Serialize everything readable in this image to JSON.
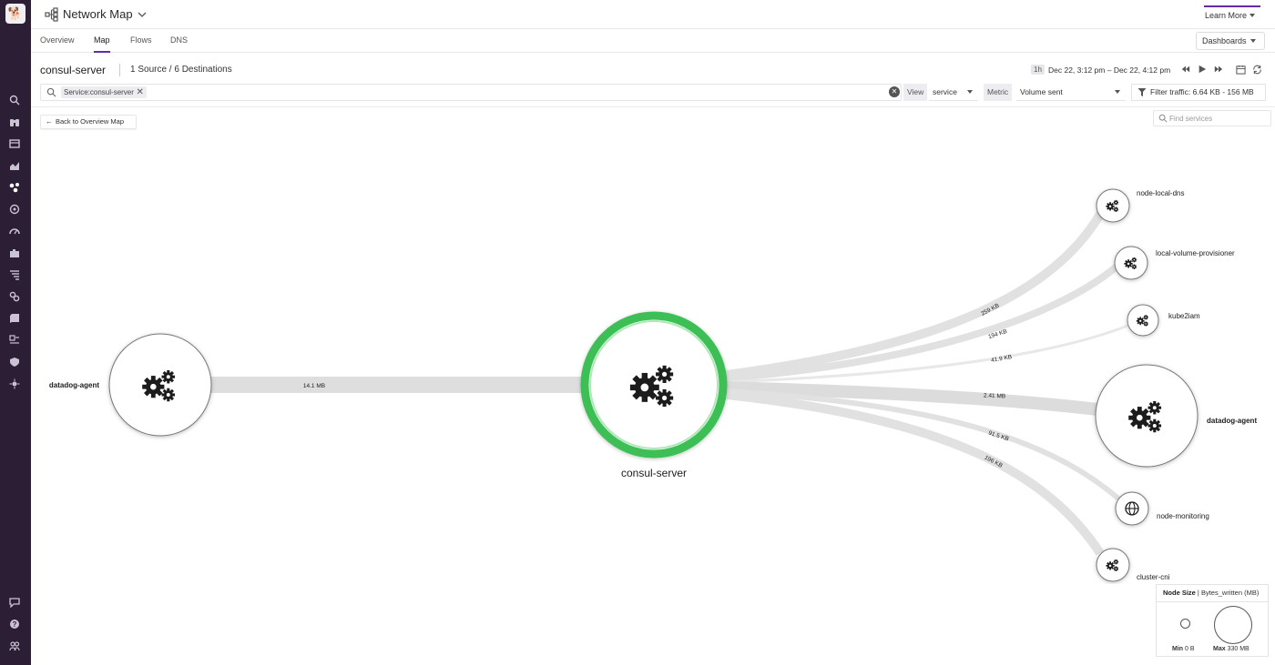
{
  "header": {
    "title": "Network Map",
    "learn_more": "Learn More"
  },
  "tabs": [
    {
      "label": "Overview"
    },
    {
      "label": "Map"
    },
    {
      "label": "Flows"
    },
    {
      "label": "DNS"
    }
  ],
  "dashboards": "Dashboards",
  "subheader": {
    "service": "consul-server",
    "sources": "1 Source / 6 Destinations",
    "time_badge": "1h",
    "time_range": "Dec 22, 3:12 pm – Dec 22, 4:12 pm"
  },
  "search": {
    "chip": "Service:consul-server"
  },
  "view": {
    "label": "View",
    "value": "service"
  },
  "metric": {
    "label": "Metric",
    "value": "Volume sent"
  },
  "filter": "Filter traffic: 6.64 KB - 156 MB",
  "back": "Back to Overview Map",
  "find": {
    "placeholder": "Find services"
  },
  "nodes": {
    "source": "datadog-agent",
    "center": "consul-server",
    "destinations": [
      {
        "label": "node-local-dns",
        "icon": "gears-icon"
      },
      {
        "label": "local-volume-provisioner",
        "icon": "gears-icon"
      },
      {
        "label": "kube2iam",
        "icon": "gears-icon"
      },
      {
        "label": "datadog-agent",
        "icon": "gears-icon"
      },
      {
        "label": "node-monitoring",
        "icon": "globe-icon"
      },
      {
        "label": "cluster-cni",
        "icon": "gears-icon"
      }
    ]
  },
  "edges": {
    "source_edge": "14.1 MB",
    "dest_edges": [
      "259 KB",
      "194 KB",
      "41.9 KB",
      "2.41 MB",
      "91.5 KB",
      "196 KB"
    ]
  },
  "legend": {
    "title": "Node Size",
    "metric": "Bytes_written (MB)",
    "min_label": "Min",
    "min_value": "0 B",
    "max_label": "Max",
    "max_value": "330 MB"
  },
  "colors": {
    "accent": "#632ca6",
    "highlight": "#3cbf54",
    "sidebar": "#2b1e35",
    "edge": "#dcdcdc"
  }
}
